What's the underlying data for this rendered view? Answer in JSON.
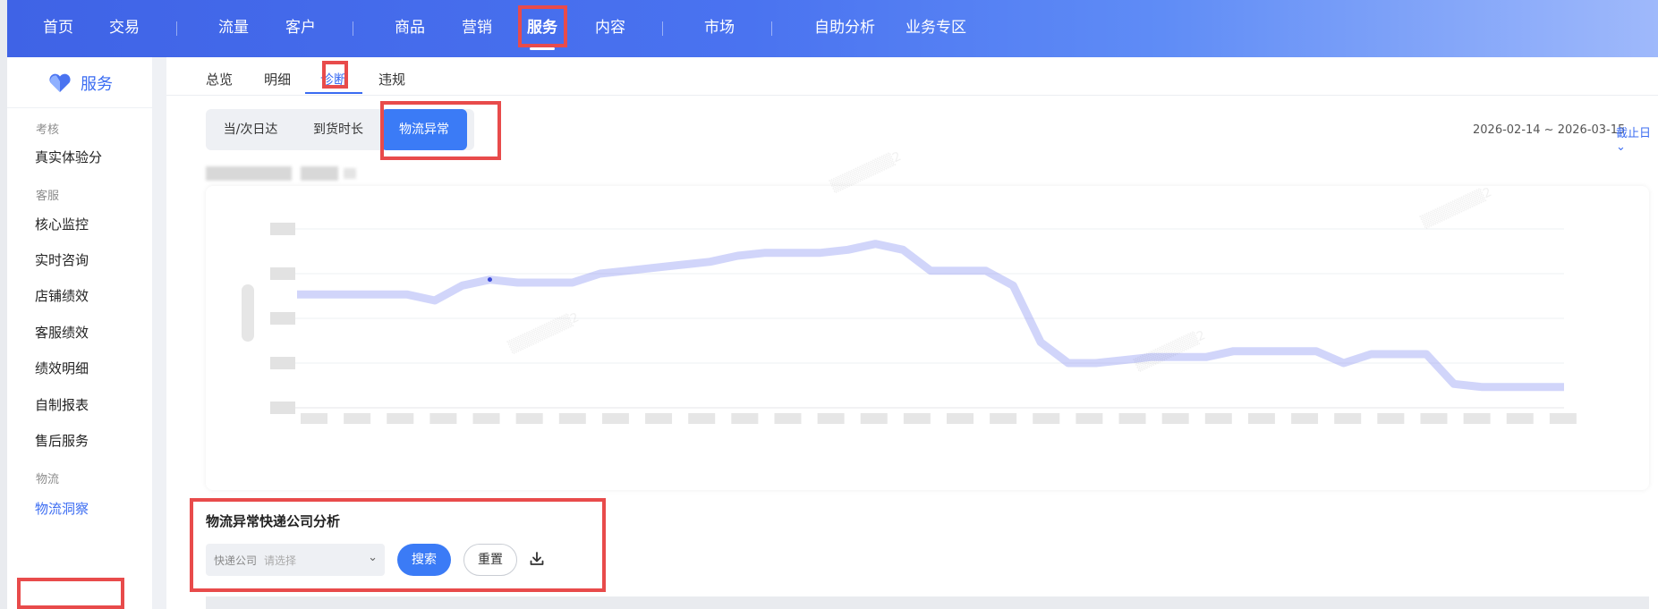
{
  "topnav": {
    "items": [
      "首页",
      "交易",
      "流量",
      "客户",
      "商品",
      "营销",
      "服务",
      "内容",
      "市场",
      "自助分析",
      "业务专区"
    ],
    "active": "服务"
  },
  "sidebar": {
    "logo_label": "服务",
    "groups": [
      {
        "title": "考核",
        "items": [
          "真实体验分"
        ]
      },
      {
        "title": "客服",
        "items": [
          "核心监控",
          "实时咨询",
          "店铺绩效",
          "客服绩效",
          "绩效明细",
          "自制报表",
          "售后服务"
        ]
      },
      {
        "title": "物流",
        "items": [
          "物流洞察"
        ]
      }
    ],
    "active_item": "物流洞察"
  },
  "subtabs": {
    "items": [
      "总览",
      "明细",
      "诊断",
      "违规"
    ],
    "active": "诊断"
  },
  "segment": {
    "options": [
      "当/次日达",
      "到货时长",
      "物流异常"
    ],
    "active": "物流异常"
  },
  "date": {
    "range": "2026-02-14 ~ 2026-03-15",
    "mode_label": "截止日"
  },
  "chart_data": {
    "type": "line",
    "series": [
      {
        "values": [
          0.78,
          0.78,
          0.78,
          0.78,
          0.78,
          0.76,
          0.81,
          0.83,
          0.82,
          0.82,
          0.82,
          0.85,
          0.86,
          0.87,
          0.88,
          0.89,
          0.91,
          0.92,
          0.92,
          0.92,
          0.93,
          0.95,
          0.93,
          0.86,
          0.86,
          0.86,
          0.81,
          0.62,
          0.55,
          0.55,
          0.56,
          0.57,
          0.57,
          0.57,
          0.59,
          0.59,
          0.59,
          0.59,
          0.55,
          0.58,
          0.58,
          0.58,
          0.48,
          0.47,
          0.47,
          0.47,
          0.47
        ]
      }
    ],
    "accent_color": "#7b86f0"
  },
  "logistics_section": {
    "title": "物流异常快递公司分析",
    "select_label": "快递公司",
    "select_placeholder": "请选择",
    "search_label": "搜索",
    "reset_label": "重置"
  }
}
